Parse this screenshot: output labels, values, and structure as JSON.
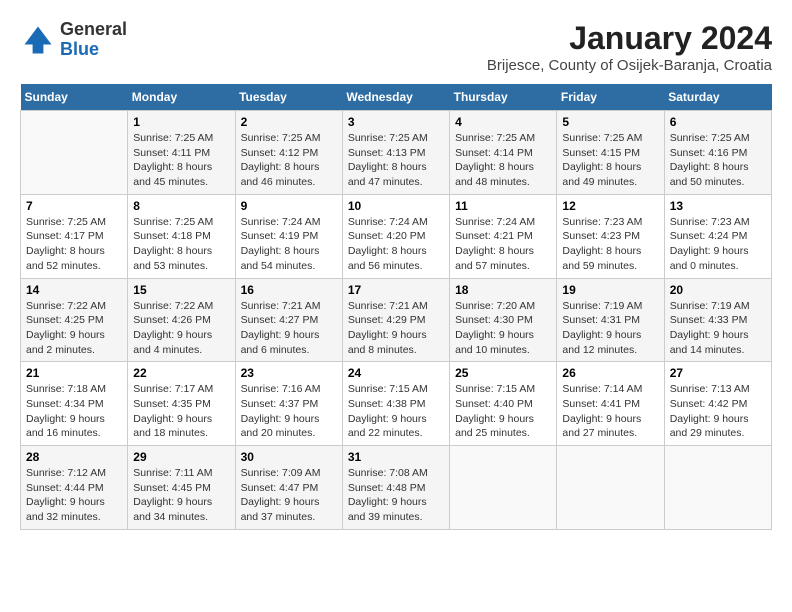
{
  "header": {
    "logo_general": "General",
    "logo_blue": "Blue",
    "title": "January 2024",
    "subtitle": "Brijesce, County of Osijek-Baranja, Croatia"
  },
  "days_of_week": [
    "Sunday",
    "Monday",
    "Tuesday",
    "Wednesday",
    "Thursday",
    "Friday",
    "Saturday"
  ],
  "weeks": [
    [
      {
        "day": "",
        "sunrise": "",
        "sunset": "",
        "daylight": ""
      },
      {
        "day": "1",
        "sunrise": "Sunrise: 7:25 AM",
        "sunset": "Sunset: 4:11 PM",
        "daylight": "Daylight: 8 hours and 45 minutes."
      },
      {
        "day": "2",
        "sunrise": "Sunrise: 7:25 AM",
        "sunset": "Sunset: 4:12 PM",
        "daylight": "Daylight: 8 hours and 46 minutes."
      },
      {
        "day": "3",
        "sunrise": "Sunrise: 7:25 AM",
        "sunset": "Sunset: 4:13 PM",
        "daylight": "Daylight: 8 hours and 47 minutes."
      },
      {
        "day": "4",
        "sunrise": "Sunrise: 7:25 AM",
        "sunset": "Sunset: 4:14 PM",
        "daylight": "Daylight: 8 hours and 48 minutes."
      },
      {
        "day": "5",
        "sunrise": "Sunrise: 7:25 AM",
        "sunset": "Sunset: 4:15 PM",
        "daylight": "Daylight: 8 hours and 49 minutes."
      },
      {
        "day": "6",
        "sunrise": "Sunrise: 7:25 AM",
        "sunset": "Sunset: 4:16 PM",
        "daylight": "Daylight: 8 hours and 50 minutes."
      }
    ],
    [
      {
        "day": "7",
        "sunrise": "Sunrise: 7:25 AM",
        "sunset": "Sunset: 4:17 PM",
        "daylight": "Daylight: 8 hours and 52 minutes."
      },
      {
        "day": "8",
        "sunrise": "Sunrise: 7:25 AM",
        "sunset": "Sunset: 4:18 PM",
        "daylight": "Daylight: 8 hours and 53 minutes."
      },
      {
        "day": "9",
        "sunrise": "Sunrise: 7:24 AM",
        "sunset": "Sunset: 4:19 PM",
        "daylight": "Daylight: 8 hours and 54 minutes."
      },
      {
        "day": "10",
        "sunrise": "Sunrise: 7:24 AM",
        "sunset": "Sunset: 4:20 PM",
        "daylight": "Daylight: 8 hours and 56 minutes."
      },
      {
        "day": "11",
        "sunrise": "Sunrise: 7:24 AM",
        "sunset": "Sunset: 4:21 PM",
        "daylight": "Daylight: 8 hours and 57 minutes."
      },
      {
        "day": "12",
        "sunrise": "Sunrise: 7:23 AM",
        "sunset": "Sunset: 4:23 PM",
        "daylight": "Daylight: 8 hours and 59 minutes."
      },
      {
        "day": "13",
        "sunrise": "Sunrise: 7:23 AM",
        "sunset": "Sunset: 4:24 PM",
        "daylight": "Daylight: 9 hours and 0 minutes."
      }
    ],
    [
      {
        "day": "14",
        "sunrise": "Sunrise: 7:22 AM",
        "sunset": "Sunset: 4:25 PM",
        "daylight": "Daylight: 9 hours and 2 minutes."
      },
      {
        "day": "15",
        "sunrise": "Sunrise: 7:22 AM",
        "sunset": "Sunset: 4:26 PM",
        "daylight": "Daylight: 9 hours and 4 minutes."
      },
      {
        "day": "16",
        "sunrise": "Sunrise: 7:21 AM",
        "sunset": "Sunset: 4:27 PM",
        "daylight": "Daylight: 9 hours and 6 minutes."
      },
      {
        "day": "17",
        "sunrise": "Sunrise: 7:21 AM",
        "sunset": "Sunset: 4:29 PM",
        "daylight": "Daylight: 9 hours and 8 minutes."
      },
      {
        "day": "18",
        "sunrise": "Sunrise: 7:20 AM",
        "sunset": "Sunset: 4:30 PM",
        "daylight": "Daylight: 9 hours and 10 minutes."
      },
      {
        "day": "19",
        "sunrise": "Sunrise: 7:19 AM",
        "sunset": "Sunset: 4:31 PM",
        "daylight": "Daylight: 9 hours and 12 minutes."
      },
      {
        "day": "20",
        "sunrise": "Sunrise: 7:19 AM",
        "sunset": "Sunset: 4:33 PM",
        "daylight": "Daylight: 9 hours and 14 minutes."
      }
    ],
    [
      {
        "day": "21",
        "sunrise": "Sunrise: 7:18 AM",
        "sunset": "Sunset: 4:34 PM",
        "daylight": "Daylight: 9 hours and 16 minutes."
      },
      {
        "day": "22",
        "sunrise": "Sunrise: 7:17 AM",
        "sunset": "Sunset: 4:35 PM",
        "daylight": "Daylight: 9 hours and 18 minutes."
      },
      {
        "day": "23",
        "sunrise": "Sunrise: 7:16 AM",
        "sunset": "Sunset: 4:37 PM",
        "daylight": "Daylight: 9 hours and 20 minutes."
      },
      {
        "day": "24",
        "sunrise": "Sunrise: 7:15 AM",
        "sunset": "Sunset: 4:38 PM",
        "daylight": "Daylight: 9 hours and 22 minutes."
      },
      {
        "day": "25",
        "sunrise": "Sunrise: 7:15 AM",
        "sunset": "Sunset: 4:40 PM",
        "daylight": "Daylight: 9 hours and 25 minutes."
      },
      {
        "day": "26",
        "sunrise": "Sunrise: 7:14 AM",
        "sunset": "Sunset: 4:41 PM",
        "daylight": "Daylight: 9 hours and 27 minutes."
      },
      {
        "day": "27",
        "sunrise": "Sunrise: 7:13 AM",
        "sunset": "Sunset: 4:42 PM",
        "daylight": "Daylight: 9 hours and 29 minutes."
      }
    ],
    [
      {
        "day": "28",
        "sunrise": "Sunrise: 7:12 AM",
        "sunset": "Sunset: 4:44 PM",
        "daylight": "Daylight: 9 hours and 32 minutes."
      },
      {
        "day": "29",
        "sunrise": "Sunrise: 7:11 AM",
        "sunset": "Sunset: 4:45 PM",
        "daylight": "Daylight: 9 hours and 34 minutes."
      },
      {
        "day": "30",
        "sunrise": "Sunrise: 7:09 AM",
        "sunset": "Sunset: 4:47 PM",
        "daylight": "Daylight: 9 hours and 37 minutes."
      },
      {
        "day": "31",
        "sunrise": "Sunrise: 7:08 AM",
        "sunset": "Sunset: 4:48 PM",
        "daylight": "Daylight: 9 hours and 39 minutes."
      },
      {
        "day": "",
        "sunrise": "",
        "sunset": "",
        "daylight": ""
      },
      {
        "day": "",
        "sunrise": "",
        "sunset": "",
        "daylight": ""
      },
      {
        "day": "",
        "sunrise": "",
        "sunset": "",
        "daylight": ""
      }
    ]
  ]
}
